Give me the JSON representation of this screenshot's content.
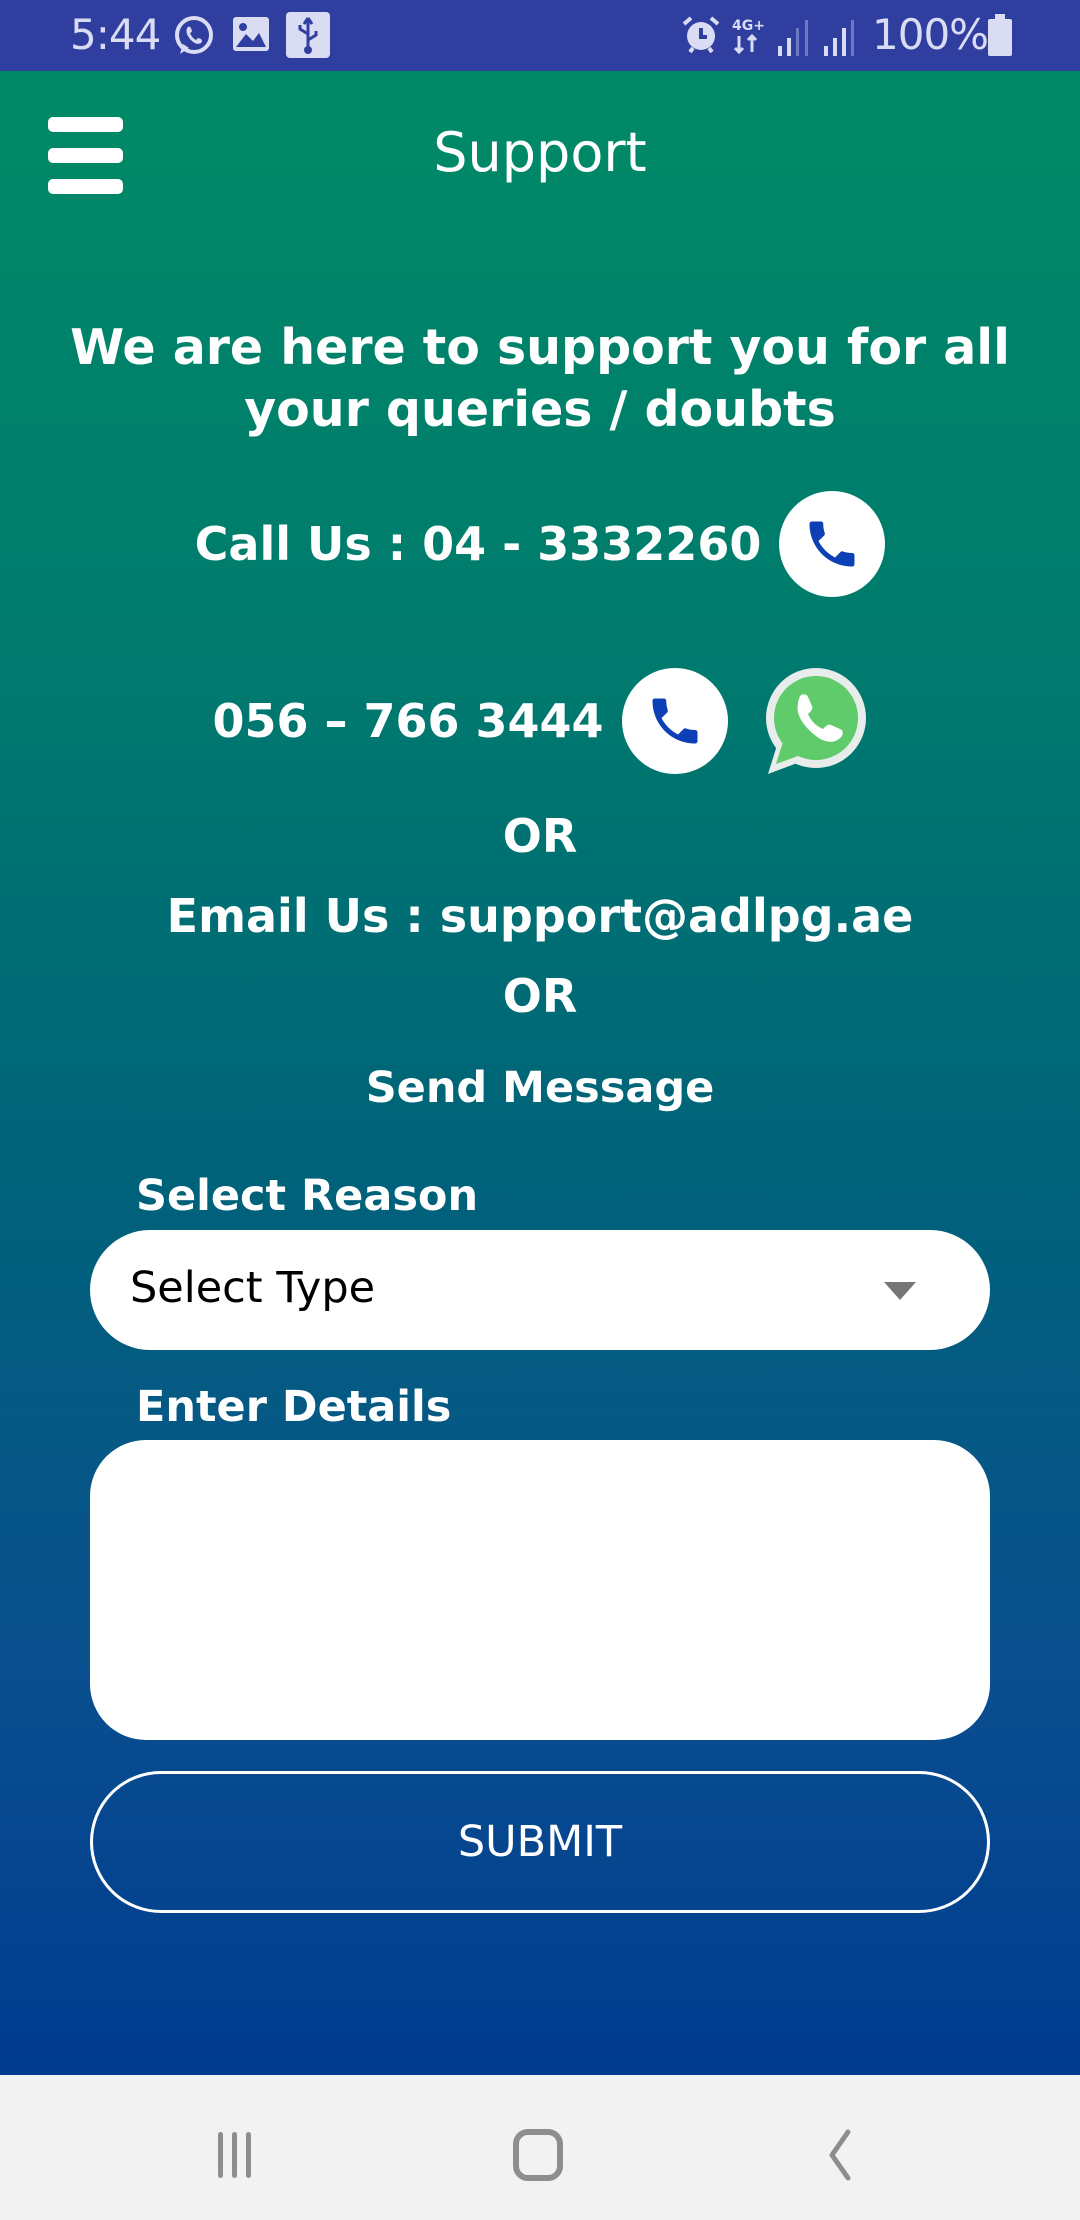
{
  "status_bar": {
    "time": "5:44",
    "left_icons": [
      "whatsapp-notification-icon",
      "gallery-notification-icon",
      "usb-icon"
    ],
    "network": "4G+",
    "battery": "100%"
  },
  "header": {
    "menu_icon": "hamburger-menu-icon",
    "title": "Support"
  },
  "content": {
    "intro": "We are here to support you for all your queries / doubts",
    "call_us": "Call Us : 04 - 3332260",
    "mobile": "056 – 766 3444",
    "or_1": "OR",
    "email_us": "Email Us : support@adlpg.ae",
    "or_2": "OR",
    "send_message": "Send Message"
  },
  "form": {
    "reason_label": "Select Reason",
    "reason_value": "Select Type",
    "details_label": "Enter Details",
    "details_value": "",
    "submit_label": "SUBMIT"
  },
  "colors": {
    "status_bar": "#303f9f",
    "gradient_top": "#008a66",
    "gradient_bottom": "#003b8f",
    "phone_icon": "#0d3fb5",
    "whatsapp_green": "#5fcb6a"
  },
  "nav_bar": {
    "buttons": [
      "recent-apps",
      "home",
      "back"
    ]
  }
}
